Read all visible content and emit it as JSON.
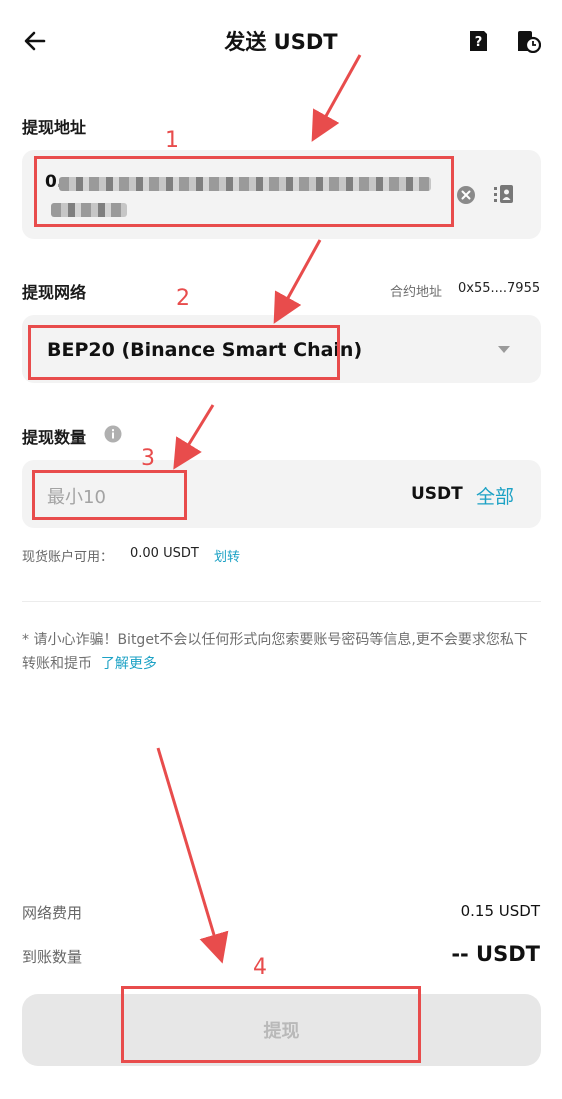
{
  "header": {
    "title": "发送 USDT"
  },
  "address": {
    "label": "提现地址",
    "value_prefix": "0."
  },
  "network": {
    "label": "提现网络",
    "contract_label": "合约地址",
    "contract_value": "0x55....7955",
    "selected": "BEP20 (Binance Smart Chain)"
  },
  "amount": {
    "label": "提现数量",
    "placeholder": "最小10",
    "currency": "USDT",
    "all_label": "全部"
  },
  "balance": {
    "label": "现货账户可用：",
    "value": "0.00 USDT",
    "transfer_label": "划转"
  },
  "warning": {
    "text": "* 请小心诈骗！Bitget不会以任何形式向您索要账号密码等信息,更不会要求您私下转账和提币",
    "link": "了解更多"
  },
  "summary": {
    "fee_label": "网络费用",
    "fee_value": "0.15 USDT",
    "receive_label": "到账数量",
    "receive_value": "-- USDT"
  },
  "submit": {
    "label": "提现"
  },
  "annotations": {
    "step1": "1",
    "step2": "2",
    "step3": "3",
    "step4": "4"
  },
  "colors": {
    "accent": "#1da2c5",
    "annotation": "#e84c4c",
    "card_bg": "#f3f3f3",
    "button_disabled": "#e7e7e7"
  }
}
